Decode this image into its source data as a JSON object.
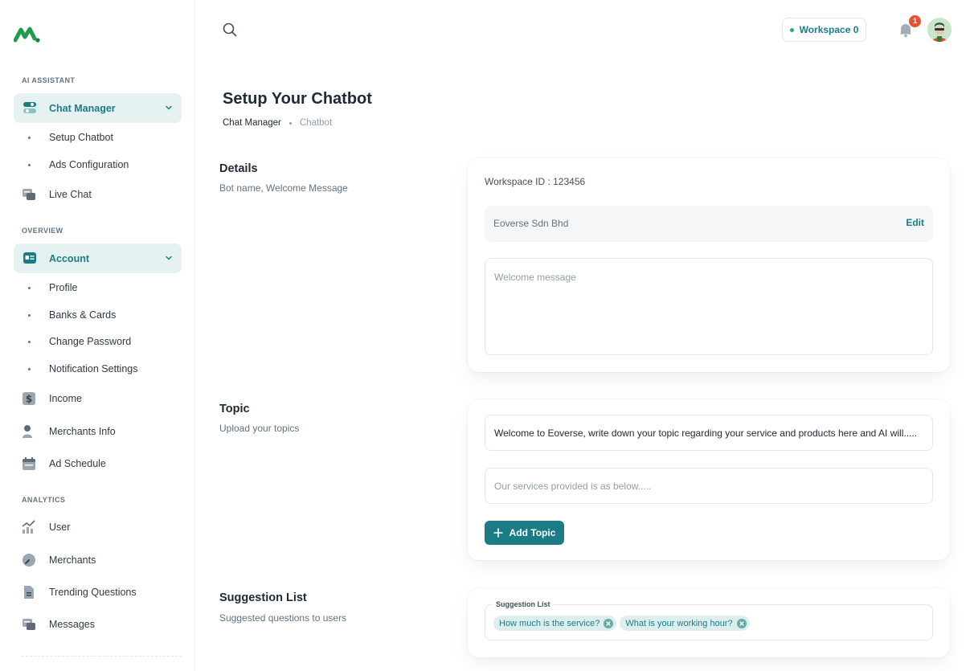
{
  "sidebar": {
    "sections": [
      "AI ASSISTANT",
      "OVERVIEW",
      "ANALYTICS"
    ],
    "chat_manager": "Chat Manager",
    "chat_sub": [
      "Setup Chatbot",
      "Ads Configuration"
    ],
    "live_chat": "Live Chat",
    "account": "Account",
    "account_sub": [
      "Profile",
      "Banks & Cards",
      "Change Password",
      "Notification Settings"
    ],
    "overview_items": [
      "Income",
      "Merchants Info",
      "Ad Schedule"
    ],
    "analytics_items": [
      "User",
      "Merchants",
      "Trending Questions",
      "Messages"
    ]
  },
  "header": {
    "workspace_label": "Workspace 0",
    "notification_count": "1"
  },
  "page": {
    "title": "Setup Your Chatbot",
    "breadcrumb": [
      "Chat Manager",
      "Chatbot"
    ]
  },
  "details": {
    "title": "Details",
    "subtitle": "Bot name, Welcome Message",
    "workspace_id": "Workspace ID : 123456",
    "bot_name": "Eoverse Sdn Bhd",
    "edit_label": "Edit",
    "welcome_placeholder": "Welcome message"
  },
  "topic": {
    "title": "Topic",
    "subtitle": "Upload your topics",
    "topic_text": "Welcome to Eoverse, write down your topic regarding your service and products here and AI will.....",
    "services_placeholder": "Our services provided is as below.....",
    "add_label": "Add Topic"
  },
  "suggestions": {
    "title": "Suggestion List",
    "subtitle": "Suggested questions to users",
    "legend": "Suggestion List",
    "chips": [
      "How much is the service?",
      "What is your working hour?"
    ]
  },
  "colors": {
    "primary": "#1b7c86",
    "active_bg": "#e6f2f1",
    "badge": "#ee4e2b"
  }
}
